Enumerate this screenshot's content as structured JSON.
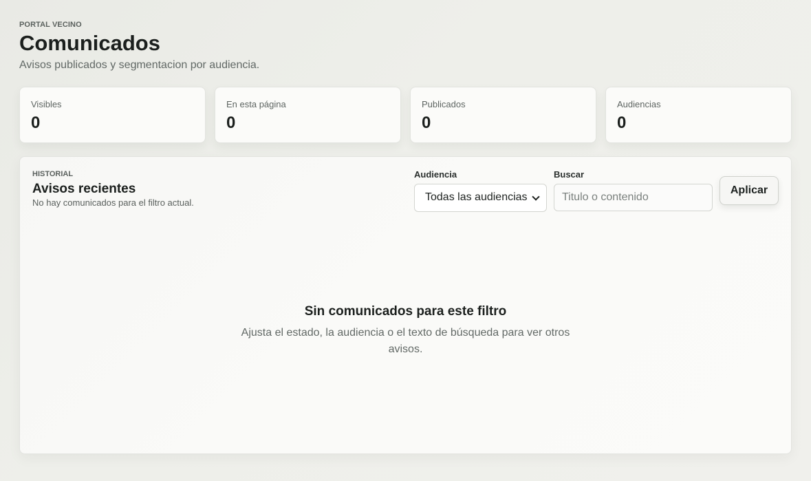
{
  "header": {
    "eyebrow": "PORTAL VECINO",
    "title": "Comunicados",
    "subtitle": "Avisos publicados y segmentacion por audiencia."
  },
  "stats": [
    {
      "label": "Visibles",
      "value": "0"
    },
    {
      "label": "En esta página",
      "value": "0"
    },
    {
      "label": "Publicados",
      "value": "0"
    },
    {
      "label": "Audiencias",
      "value": "0"
    }
  ],
  "panel": {
    "eyebrow": "HISTORIAL",
    "title": "Avisos recientes",
    "note": "No hay comunicados para el filtro actual.",
    "filters": {
      "audience_label": "Audiencia",
      "audience_selected": "Todas las audiencias",
      "search_label": "Buscar",
      "search_placeholder": "Titulo o contenido",
      "search_value": "",
      "apply_label": "Aplicar"
    },
    "empty": {
      "title": "Sin comunicados para este filtro",
      "text": "Ajusta el estado, la audiencia o el texto de búsqueda para ver otros avisos."
    }
  },
  "icons": {
    "audience_select": "chevron-down-icon"
  }
}
